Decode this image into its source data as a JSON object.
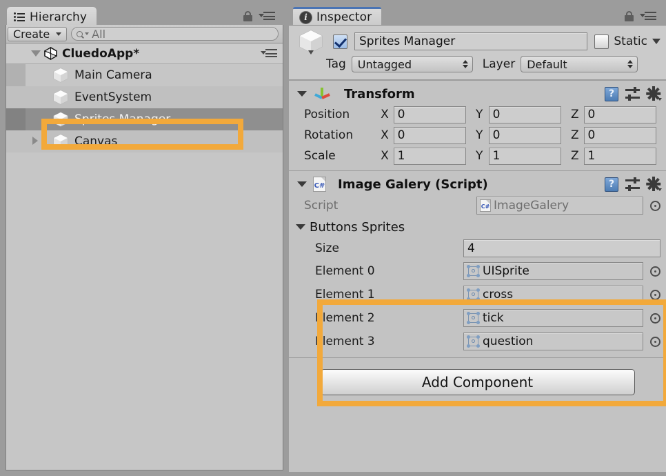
{
  "hierarchy": {
    "tab_label": "Hierarchy",
    "tab_icon": "hierarchy-list-icon",
    "lock_icon": "lock-icon",
    "menu_icon": "panel-menu-icon",
    "create_label": "Create",
    "search_placeholder": "All",
    "search_icon": "search-icon",
    "scene_name": "CluedoApp*",
    "scene_icon": "unity-logo-icon",
    "items": [
      {
        "label": "Main Camera",
        "icon": "gameobject-cube-icon",
        "expandable": false,
        "selected": false
      },
      {
        "label": "EventSystem",
        "icon": "gameobject-cube-icon",
        "expandable": false,
        "selected": false
      },
      {
        "label": "Sprites Manager",
        "icon": "gameobject-cube-icon",
        "expandable": false,
        "selected": true
      },
      {
        "label": "Canvas",
        "icon": "gameobject-cube-icon",
        "expandable": true,
        "selected": false
      }
    ]
  },
  "inspector": {
    "tab_label": "Inspector",
    "tab_icon": "info-icon",
    "lock_icon": "lock-icon",
    "menu_icon": "panel-menu-icon",
    "object": {
      "enabled": true,
      "name": "Sprites Manager",
      "icon": "gameobject-cube-icon",
      "static_label": "Static",
      "static_checked": false,
      "tag_label": "Tag",
      "tag_value": "Untagged",
      "layer_label": "Layer",
      "layer_value": "Default"
    },
    "transform": {
      "title": "Transform",
      "icon": "transform-axis-icon",
      "help_icon": "help-book-icon",
      "preset_icon": "preset-sliders-icon",
      "gear_icon": "gear-icon",
      "rows": [
        {
          "name": "Position",
          "x": "0",
          "y": "0",
          "z": "0"
        },
        {
          "name": "Rotation",
          "x": "0",
          "y": "0",
          "z": "0"
        },
        {
          "name": "Scale",
          "x": "1",
          "y": "1",
          "z": "1"
        }
      ],
      "axis_labels": {
        "x": "X",
        "y": "Y",
        "z": "Z"
      }
    },
    "image_gallery": {
      "title": "Image Galery (Script)",
      "icon": "csharp-script-icon",
      "help_icon": "help-book-icon",
      "preset_icon": "preset-sliders-icon",
      "gear_icon": "gear-icon",
      "script_label": "Script",
      "script_value": "ImageGalery",
      "script_value_icon": "csharp-script-icon",
      "script_picker_icon": "object-picker-icon",
      "array_label": "Buttons Sprites",
      "size_label": "Size",
      "size_value": "4",
      "elements": [
        {
          "label": "Element 0",
          "value": "UISprite",
          "icon": "sprite-icon",
          "picker_icon": "object-picker-icon"
        },
        {
          "label": "Element 1",
          "value": "cross",
          "icon": "sprite-icon",
          "picker_icon": "object-picker-icon"
        },
        {
          "label": "Element 2",
          "value": "tick",
          "icon": "sprite-icon",
          "picker_icon": "object-picker-icon"
        },
        {
          "label": "Element 3",
          "value": "question",
          "icon": "sprite-icon",
          "picker_icon": "object-picker-icon"
        }
      ]
    },
    "add_component_label": "Add Component"
  },
  "annotations": {
    "highlight_color": "#f2a93b",
    "boxes": [
      {
        "name": "hierarchy-selected-highlight"
      },
      {
        "name": "sprite-elements-highlight"
      }
    ]
  },
  "colors": {
    "accent_blue": "#4a74b4",
    "panel_bg": "#c3c3c3",
    "window_bg": "#9c9c9c",
    "selection_row": "#8f8f8f"
  }
}
